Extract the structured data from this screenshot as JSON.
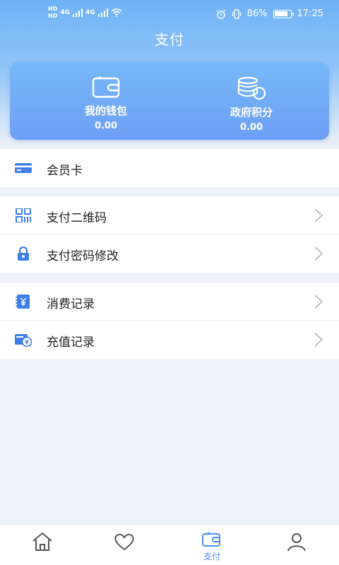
{
  "status_bar": {
    "hd1": "HD",
    "hd2": "HD",
    "net1": "4G",
    "net2": "4G",
    "battery_percent": "86%",
    "battery_level": 0.86,
    "time": "17:25"
  },
  "header": {
    "title": "支付"
  },
  "wallet_card": {
    "wallet_label": "我的钱包",
    "wallet_value": "0.00",
    "points_label": "政府积分",
    "points_value": "0.00"
  },
  "menu": {
    "member_card": "会员卡",
    "pay_qrcode": "支付二维码",
    "pay_password": "支付密码修改",
    "consume_record": "消费记录",
    "recharge_record": "充值记录"
  },
  "bottom_nav": {
    "pay_label": "支付"
  },
  "colors": {
    "accent": "#4a8ef3",
    "icon_blue": "#3f7ee8"
  }
}
